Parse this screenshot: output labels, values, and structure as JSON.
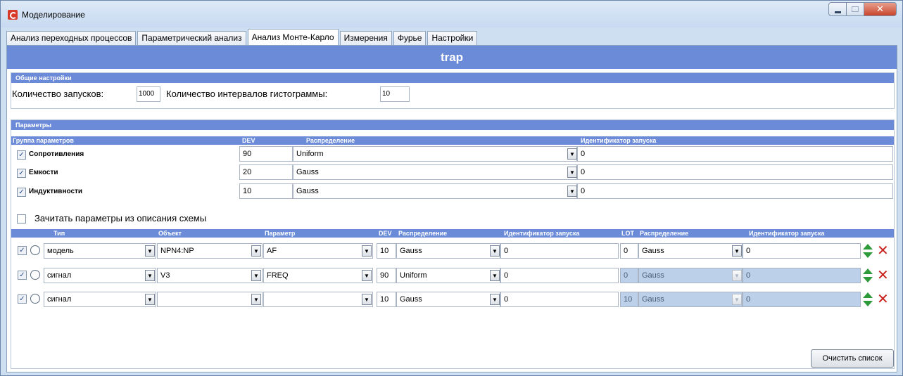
{
  "window": {
    "title": "Моделирование"
  },
  "tabs": [
    "Анализ переходных процессов",
    "Параметрический анализ",
    "Анализ Монте-Карло",
    "Измерения",
    "Фурье",
    "Настройки"
  ],
  "header": {
    "title": "trap"
  },
  "general": {
    "section_title": "Общие настройки",
    "runs_label": "Количество запусков:",
    "runs_value": "1000",
    "intervals_label": "Количество интервалов гистограммы:",
    "intervals_value": "10"
  },
  "params": {
    "section_title": "Параметры",
    "columns": {
      "group": "Группа параметров",
      "dev": "DEV",
      "dist": "Распределение",
      "run_id": "Идентификатор запуска"
    },
    "rows": [
      {
        "name": "Сопротивления",
        "checked": true,
        "dev": "90",
        "dist": "Uniform",
        "run_id": "0"
      },
      {
        "name": "Емкости",
        "checked": true,
        "dev": "20",
        "dist": "Gauss",
        "run_id": "0"
      },
      {
        "name": "Индуктивности",
        "checked": true,
        "dev": "10",
        "dist": "Gauss",
        "run_id": "0"
      }
    ]
  },
  "read_params_label": "Зачитать параметры из описания схемы",
  "custom": {
    "columns": {
      "type": "Тип",
      "object": "Объект",
      "param": "Параметр",
      "dev": "DEV",
      "dist": "Распределение",
      "run_id": "Идентификатор запуска",
      "lot": "LOT",
      "dist2": "Распределение",
      "run_id2": "Идентификатор запуска"
    },
    "rows": [
      {
        "type": "модель",
        "object": "NPN4:NP",
        "param": "AF",
        "dev": "10",
        "dist": "Gauss",
        "run_id": "0",
        "lot": "0",
        "dist2": "Gauss",
        "run_id2": "0",
        "lot_disabled": false
      },
      {
        "type": "сигнал",
        "object": "V3",
        "param": "FREQ",
        "dev": "90",
        "dist": "Uniform",
        "run_id": "0",
        "lot": "0",
        "dist2": "Gauss",
        "run_id2": "0",
        "lot_disabled": true
      },
      {
        "type": "сигнал",
        "object": "",
        "param": "",
        "dev": "10",
        "dist": "Gauss",
        "run_id": "0",
        "lot": "10",
        "dist2": "Gauss",
        "run_id2": "0",
        "lot_disabled": true
      }
    ]
  },
  "clear_button": "Очистить список",
  "colors": {
    "accent": "#6b8bd9",
    "delete": "#c8221c",
    "move": "#2e9a3a"
  }
}
